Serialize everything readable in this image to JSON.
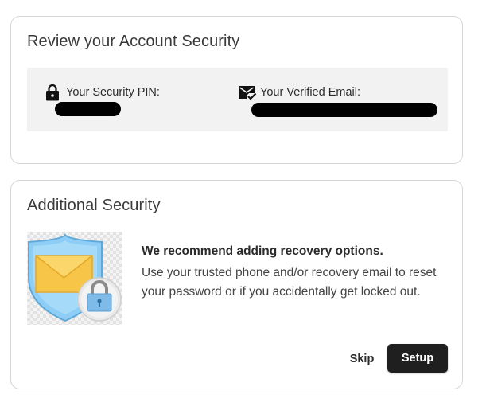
{
  "review": {
    "title": "Review your Account Security",
    "pin_label": "Your Security PIN:",
    "email_label": "Your Verified Email:"
  },
  "additional": {
    "title": "Additional Security",
    "recommend_title": "We recommend adding recovery options.",
    "recommend_body": "Use your trusted phone and/or recovery email to reset your password or if you accidentally get locked out.",
    "skip_label": "Skip",
    "setup_label": "Setup"
  },
  "icons": {
    "pin": "lock-icon",
    "email": "verified-email-icon",
    "illustration": "shield-envelope-lock-illustration"
  },
  "colors": {
    "button_primary": "#1f1f1f",
    "info_box_bg": "#f2f2f2",
    "shield": "#8ecdf5",
    "envelope": "#f7c548"
  }
}
